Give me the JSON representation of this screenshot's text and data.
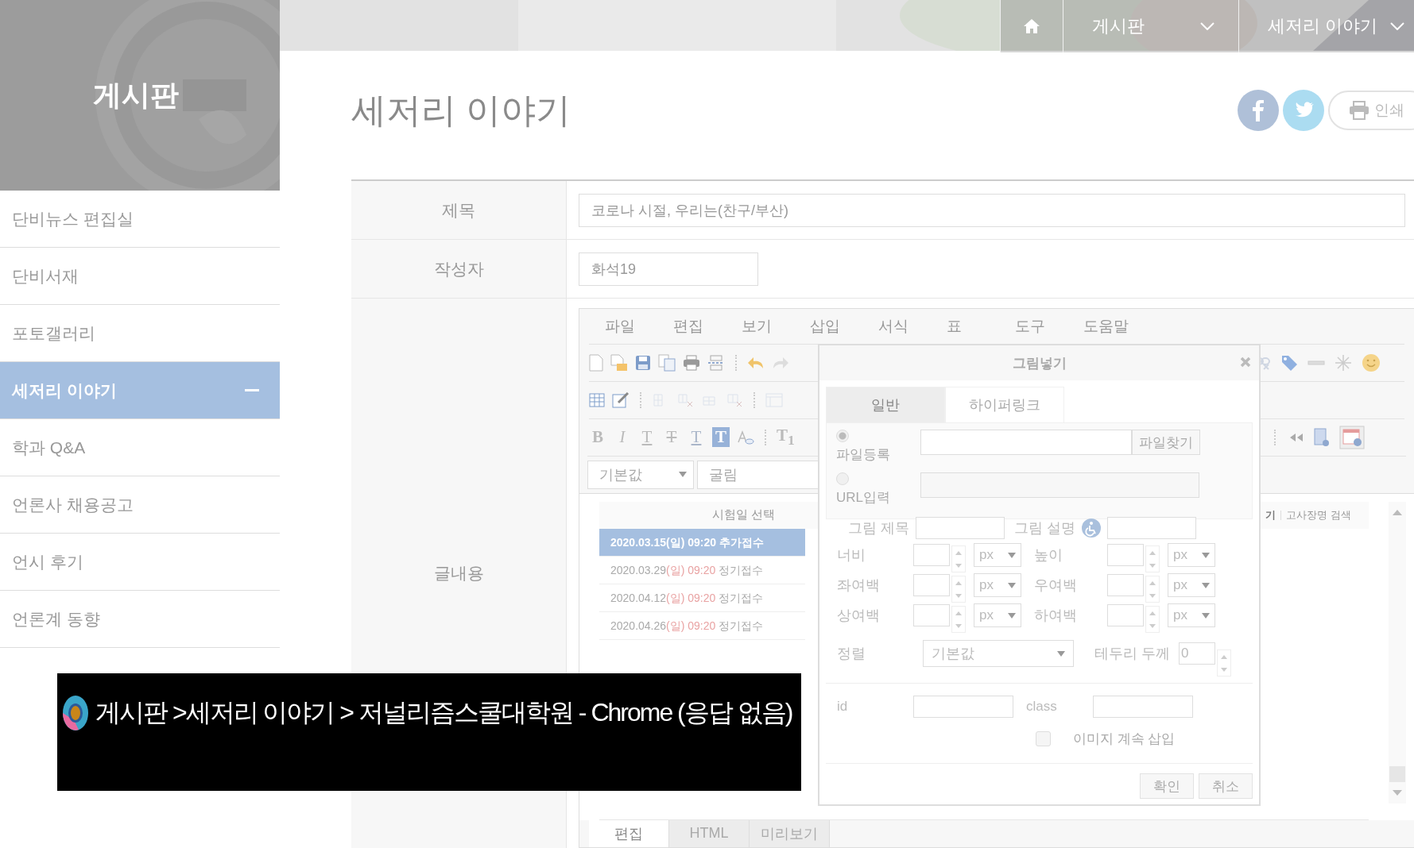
{
  "top_nav": {
    "items": [
      {
        "kind": "home"
      },
      {
        "kind": "dropdown",
        "label": "게시판"
      },
      {
        "kind": "dropdown",
        "label": "세저리 이야기"
      }
    ]
  },
  "sidebar": {
    "title": "게시판",
    "items": [
      {
        "label": "단비뉴스 편집실",
        "selected": false
      },
      {
        "label": "단비서재",
        "selected": false
      },
      {
        "label": "포토갤러리",
        "selected": false
      },
      {
        "label": "세저리 이야기",
        "selected": true
      },
      {
        "label": "학과 Q&A",
        "selected": false
      },
      {
        "label": "언론사 채용공고",
        "selected": false
      },
      {
        "label": "언시 후기",
        "selected": false
      },
      {
        "label": "언론계 동향",
        "selected": false
      }
    ]
  },
  "page": {
    "title": "세저리 이야기",
    "print_label": "인쇄"
  },
  "form": {
    "rows": [
      {
        "label": "제목",
        "value": "코로나 시절, 우리는(찬구/부산)"
      },
      {
        "label": "작성자",
        "value": "화석19"
      },
      {
        "label": "글내용"
      }
    ]
  },
  "editor": {
    "menu": [
      "파일",
      "편집",
      "보기",
      "삽입",
      "서식",
      "표",
      "도구",
      "도움말"
    ],
    "format_buttons": [
      "B",
      "I",
      "T",
      "T",
      "T",
      "T",
      "T$_{1}$"
    ],
    "selects": [
      "기본값",
      "굴림"
    ],
    "list_title": "시험일 선택",
    "side_link_partial": "기",
    "side_link": "고사장명 검색",
    "dates": [
      {
        "date": "2020.03.15",
        "day": "(일)",
        "time": "09:20",
        "type": "추가접수",
        "selected": true
      },
      {
        "date": "2020.03.29",
        "day": "(일)",
        "time": "09:20",
        "type": "정기접수",
        "selected": false
      },
      {
        "date": "2020.04.12",
        "day": "(일)",
        "time": "09:20",
        "type": "정기접수",
        "selected": false
      },
      {
        "date": "2020.04.26",
        "day": "(일)",
        "time": "09:20",
        "type": "정기접수",
        "selected": false
      }
    ],
    "mode_tabs": [
      {
        "label": "편집",
        "selected": true
      },
      {
        "label": "HTML",
        "selected": false
      },
      {
        "label": "미리보기",
        "selected": false
      }
    ]
  },
  "dialog": {
    "title": "그림넣기",
    "tabs": [
      {
        "label": "일반",
        "selected": true
      },
      {
        "label": "하이퍼링크",
        "selected": false
      }
    ],
    "sources": [
      {
        "label": "파일등록",
        "selected": true,
        "button": "파일찾기"
      },
      {
        "label": "URL입력",
        "selected": false
      }
    ],
    "image_title_label": "그림 제목",
    "image_desc_label": "그림 설명",
    "size_rows": [
      {
        "left": "너비",
        "right": "높이",
        "unit_left": "px",
        "unit_right": "px"
      },
      {
        "left": "좌여백",
        "right": "우여백",
        "unit_left": "px",
        "unit_right": "px"
      },
      {
        "left": "상여백",
        "right": "하여백",
        "unit_left": "px",
        "unit_right": "px"
      }
    ],
    "align": {
      "label": "정렬",
      "value": "기본값"
    },
    "border": {
      "label": "테두리 두께",
      "value": "0"
    },
    "id_label": "id",
    "class_label": "class",
    "continue_insert": {
      "label": "이미지 계속 삽입",
      "checked": false
    },
    "buttons": [
      "확인",
      "취소"
    ]
  },
  "overlay_window": {
    "title": "게시판 >세저리 이야기 > 저널리즘스쿨대학원 - Chrome (응답 없음)"
  }
}
